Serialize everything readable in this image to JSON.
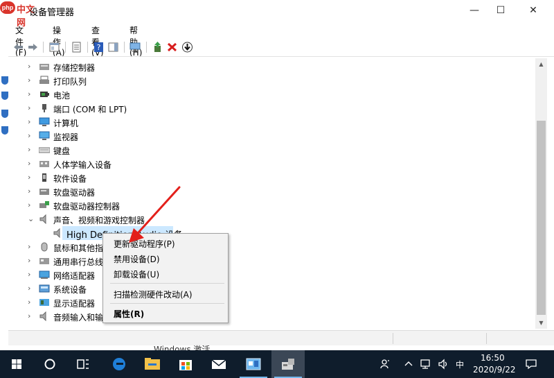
{
  "watermark": {
    "badge": "php",
    "text": "中文网"
  },
  "window": {
    "title": "设备管理器",
    "controls": {
      "minimize": "—",
      "maximize": "☐",
      "close": "✕"
    }
  },
  "menu": [
    "文件(F)",
    "操作(A)",
    "查看(V)",
    "帮助(H)"
  ],
  "toolbar_icons": [
    "back-icon",
    "forward-icon",
    "console-tree-icon",
    "properties-icon",
    "help-icon",
    "action-pane-icon",
    "scan-hardware-icon",
    "update-driver-icon",
    "uninstall-icon",
    "download-icon"
  ],
  "tree": {
    "items": [
      {
        "label": "存储控制器",
        "icon": "storage-controller-icon",
        "expanded": false
      },
      {
        "label": "打印队列",
        "icon": "printer-icon",
        "expanded": false
      },
      {
        "label": "电池",
        "icon": "battery-icon",
        "expanded": false
      },
      {
        "label": "端口 (COM 和 LPT)",
        "icon": "port-icon",
        "expanded": false
      },
      {
        "label": "计算机",
        "icon": "computer-icon",
        "expanded": false
      },
      {
        "label": "监视器",
        "icon": "monitor-icon",
        "expanded": false
      },
      {
        "label": "键盘",
        "icon": "keyboard-icon",
        "expanded": false
      },
      {
        "label": "人体学输入设备",
        "icon": "hid-icon",
        "expanded": false
      },
      {
        "label": "软件设备",
        "icon": "software-device-icon",
        "expanded": false
      },
      {
        "label": "软盘驱动器",
        "icon": "floppy-icon",
        "expanded": false
      },
      {
        "label": "软盘驱动器控制器",
        "icon": "floppy-controller-icon",
        "expanded": false
      },
      {
        "label": "声音、视频和游戏控制器",
        "icon": "speaker-icon",
        "expanded": true
      },
      {
        "label": "High Definition Audio 设备",
        "icon": "speaker-icon",
        "child": true,
        "selected": true
      },
      {
        "label": "鼠标和其他指针设备",
        "icon": "mouse-icon",
        "expanded": false
      },
      {
        "label": "通用串行总线控制器",
        "icon": "usb-icon",
        "expanded": false
      },
      {
        "label": "网络适配器",
        "icon": "network-icon",
        "expanded": false
      },
      {
        "label": "系统设备",
        "icon": "system-device-icon",
        "expanded": false
      },
      {
        "label": "显示适配器",
        "icon": "display-adapter-icon",
        "expanded": false
      },
      {
        "label": "音频输入和输出",
        "icon": "speaker-icon",
        "expanded": false
      }
    ]
  },
  "context_menu": {
    "items": [
      "更新驱动程序(P)",
      "禁用设备(D)",
      "卸载设备(U)",
      "扫描检测硬件改动(A)",
      "属性(R)"
    ]
  },
  "activation_watermark": "Windows 激活",
  "taskbar": {
    "time": "16:50",
    "date": "2020/9/22",
    "ime": "中",
    "apps": [
      "windows-start-icon",
      "cortana-icon",
      "task-view-icon",
      "edge-icon",
      "file-explorer-icon",
      "store-icon",
      "mail-icon",
      "photo-app-icon",
      "device-manager-app-icon"
    ]
  },
  "colors": {
    "selection": "#cce8ff",
    "arrow": "#e3201b",
    "taskbar": "#0f1d2c"
  }
}
